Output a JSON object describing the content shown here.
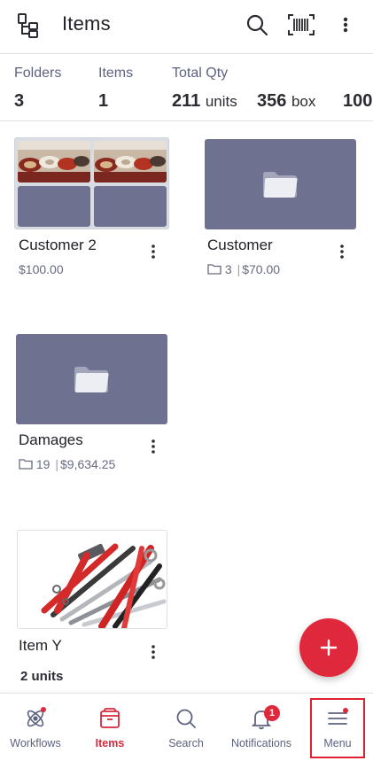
{
  "header": {
    "title": "Items",
    "icons": [
      "tree-view-icon",
      "search-icon",
      "barcode-scan-icon",
      "more-vertical-icon"
    ]
  },
  "stats": {
    "folders_label": "Folders",
    "folders_value": "3",
    "items_label": "Items",
    "items_value": "1",
    "total_qty_label": "Total Qty",
    "qty_units_value": "211",
    "qty_units_unit": "units",
    "qty_box_value": "356",
    "qty_box_unit": "box",
    "qty_more_value": "100"
  },
  "cards": [
    {
      "name": "Customer 2",
      "price": "$100.00"
    },
    {
      "name": "Customer",
      "folder_count": "3",
      "price": "$70.00"
    },
    {
      "name": "Damages",
      "folder_count": "19",
      "price": "$9,634.25"
    },
    {
      "name": "Item Y",
      "quantity": "2 units"
    }
  ],
  "fab": {
    "icon": "plus-icon"
  },
  "bottom_nav": {
    "workflows": "Workflows",
    "items": "Items",
    "search": "Search",
    "notifications": "Notifications",
    "notifications_badge": "1",
    "menu": "Menu"
  },
  "colors": {
    "accent": "#e0283c",
    "folder_thumb": "#6f7190",
    "text_muted": "#5d6280"
  }
}
